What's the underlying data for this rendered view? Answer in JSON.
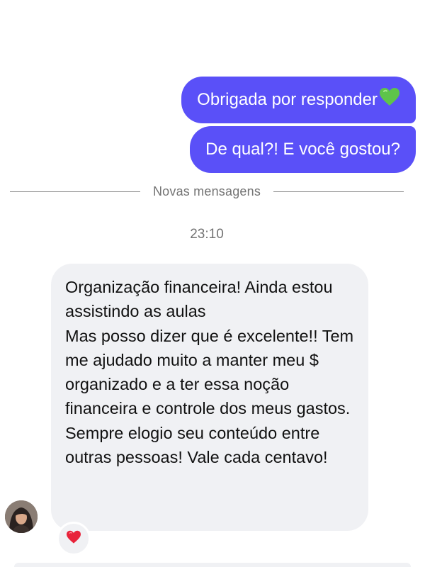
{
  "messages_out": [
    {
      "text": "Obrigada por responder",
      "emoji": "green-heart-icon"
    },
    {
      "text": "De qual?! E você gostou?"
    }
  ],
  "divider": {
    "label": "Novas mensagens"
  },
  "timestamp": "23:10",
  "message_in": {
    "lines": [
      "Organização financeira! Ainda estou assistindo as aulas",
      "Mas posso dizer que é excelente!! Tem me ajudado muito a manter meu $ organizado e a ter essa noção financeira e controle dos meus gastos. Sempre elogio seu conteúdo entre outras pessoas! Vale cada centavo!"
    ],
    "reaction": "red-heart-icon"
  },
  "colors": {
    "outgoing_bubble": "#5a50f8",
    "incoming_bubble": "#f0f1f4",
    "meta_text": "#737373"
  }
}
